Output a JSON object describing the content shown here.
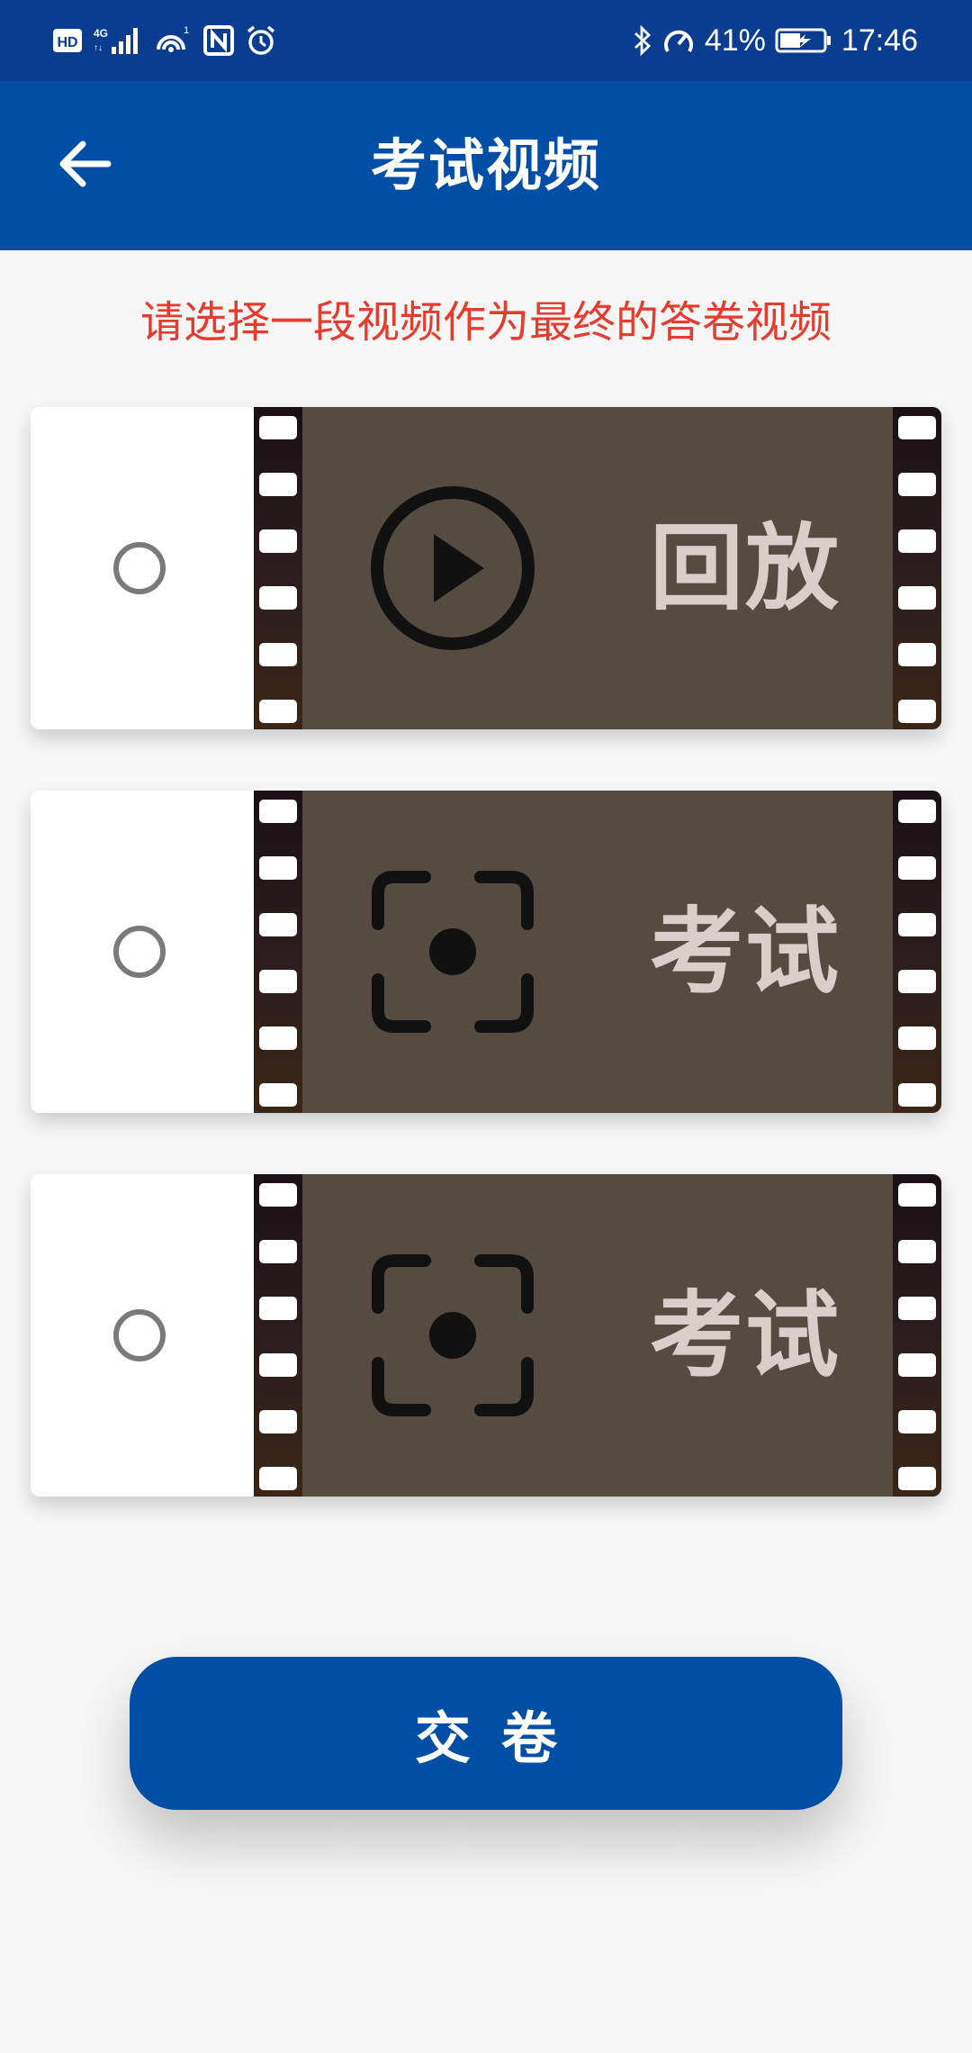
{
  "status_bar": {
    "battery": "41%",
    "time": "17:46",
    "left_icons": [
      "hd-icon",
      "signal-4g-icon",
      "hotspot-icon",
      "nfc-icon",
      "alarm-icon"
    ],
    "right_icons": [
      "bluetooth-icon",
      "speedometer-icon",
      "battery-icon"
    ]
  },
  "app_bar": {
    "title": "考试视频",
    "back_icon": "arrow-left-icon"
  },
  "instruction": "请选择一段视频作为最终的答卷视频",
  "videos": [
    {
      "label": "回放",
      "icon": "play-circle-icon",
      "selected": false
    },
    {
      "label": "考试",
      "icon": "camera-focus-icon",
      "selected": false
    },
    {
      "label": "考试",
      "icon": "camera-focus-icon",
      "selected": false
    }
  ],
  "submit_label": "交卷",
  "colors": {
    "status_bar": "#0a3d8f",
    "primary": "#004ea6",
    "instruction": "#e53c2f",
    "film_bg": "#554b41"
  }
}
